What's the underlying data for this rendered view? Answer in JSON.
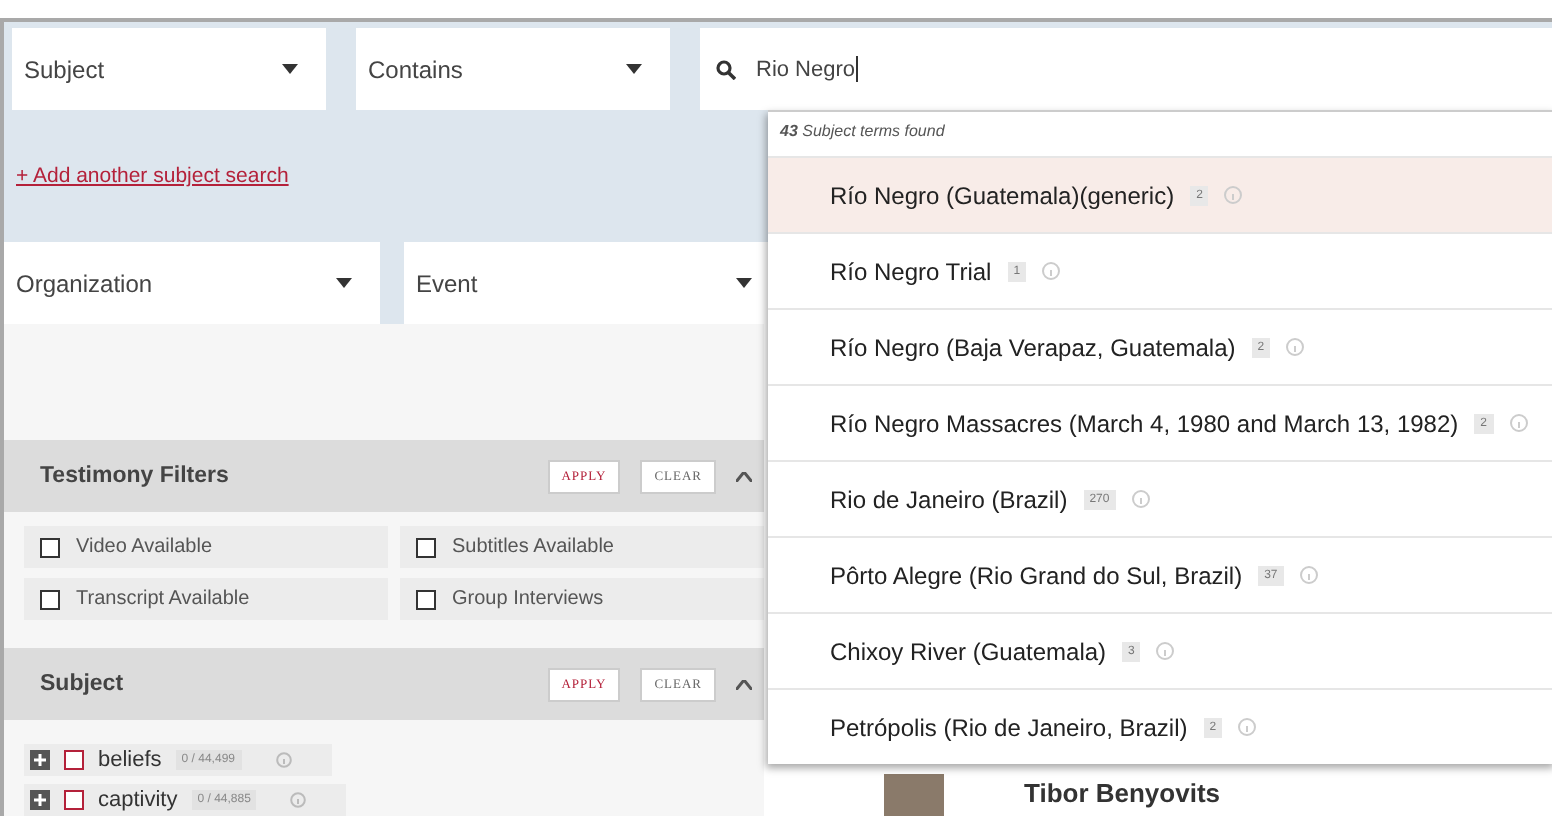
{
  "search_row": {
    "field": "Subject",
    "operator": "Contains",
    "query": "Rio Negro"
  },
  "add_link": "+ Add another subject search",
  "filter_row": [
    {
      "label": "Organization"
    },
    {
      "label": "Event"
    }
  ],
  "testimony_filters": {
    "title": "Testimony Filters",
    "apply": "APPLY",
    "clear": "CLEAR",
    "expanded": true,
    "options": [
      {
        "label": "Video Available",
        "checked": false
      },
      {
        "label": "Subtitles Available",
        "checked": false
      },
      {
        "label": "Transcript Available",
        "checked": false
      },
      {
        "label": "Group Interviews",
        "checked": false
      }
    ]
  },
  "subject_facet": {
    "title": "Subject",
    "apply": "APPLY",
    "clear": "CLEAR",
    "expanded": true,
    "terms": [
      {
        "label": "beliefs",
        "count": "0 / 44,499",
        "checked": false
      },
      {
        "label": "captivity",
        "count": "0 / 44,885",
        "checked": false
      }
    ]
  },
  "results": [
    {
      "name": "Tibor Benyovits"
    }
  ],
  "suggestions": {
    "summary": "**43** Subject terms found",
    "items": [
      {
        "label": "Río Negro (Guatemala)(generic)",
        "count": "2",
        "selected": true
      },
      {
        "label": "Río Negro Trial",
        "count": "1",
        "selected": false
      },
      {
        "label": "Río Negro (Baja Verapaz, Guatemala)",
        "count": "2",
        "selected": false
      },
      {
        "label": "Río Negro Massacres (March 4, 1980 and March 13, 1982)",
        "count": "2",
        "selected": false
      },
      {
        "label": "Rio de Janeiro (Brazil)",
        "count": "270",
        "selected": false
      },
      {
        "label": "Pôrto Alegre (Rio Grand do Sul, Brazil)",
        "count": "37",
        "selected": false
      },
      {
        "label": "Chixoy River (Guatemala)",
        "count": "3",
        "selected": false
      },
      {
        "label": "Petrópolis (Rio de Janeiro, Brazil)",
        "count": "2",
        "selected": false
      }
    ]
  }
}
